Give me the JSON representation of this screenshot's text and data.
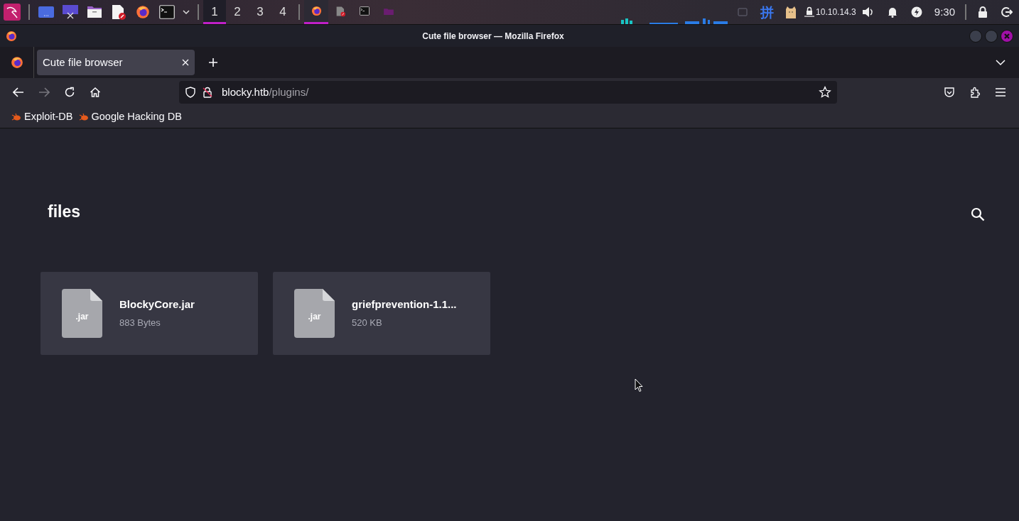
{
  "taskbar": {
    "launchers": [
      {
        "kind": "desktop"
      },
      {
        "kind": "screenshot"
      },
      {
        "kind": "folder"
      },
      {
        "kind": "editor"
      },
      {
        "kind": "browser"
      },
      {
        "kind": "terminal"
      }
    ],
    "workspaces": [
      {
        "label": "1",
        "selected": true
      },
      {
        "label": "2",
        "selected": false
      },
      {
        "label": "3",
        "selected": false
      },
      {
        "label": "4",
        "selected": false
      }
    ],
    "tasks": [
      {
        "kind": "browser",
        "selected": true
      },
      {
        "kind": "editor",
        "selected": false
      },
      {
        "kind": "terminal",
        "selected": false
      },
      {
        "kind": "folder",
        "selected": false
      }
    ],
    "tray": {
      "input_method": "拼",
      "ip": "10.10.14.3",
      "clock": "9:30"
    }
  },
  "window": {
    "title": "Cute file browser — Mozilla Firefox"
  },
  "tabs": [
    {
      "title": "Cute file browser",
      "selected": true
    }
  ],
  "address_bar": {
    "host": "blocky.htb",
    "path": "/plugins/"
  },
  "bookmarks": [
    {
      "label": "Exploit-DB"
    },
    {
      "label": "Google Hacking DB"
    }
  ],
  "page": {
    "heading": "files",
    "files": [
      {
        "type_label": ".jar",
        "name": "BlockyCore.jar",
        "size": "883 Bytes"
      },
      {
        "type_label": ".jar",
        "name": "griefprevention-1.1...",
        "size": "520 KB"
      }
    ]
  }
}
